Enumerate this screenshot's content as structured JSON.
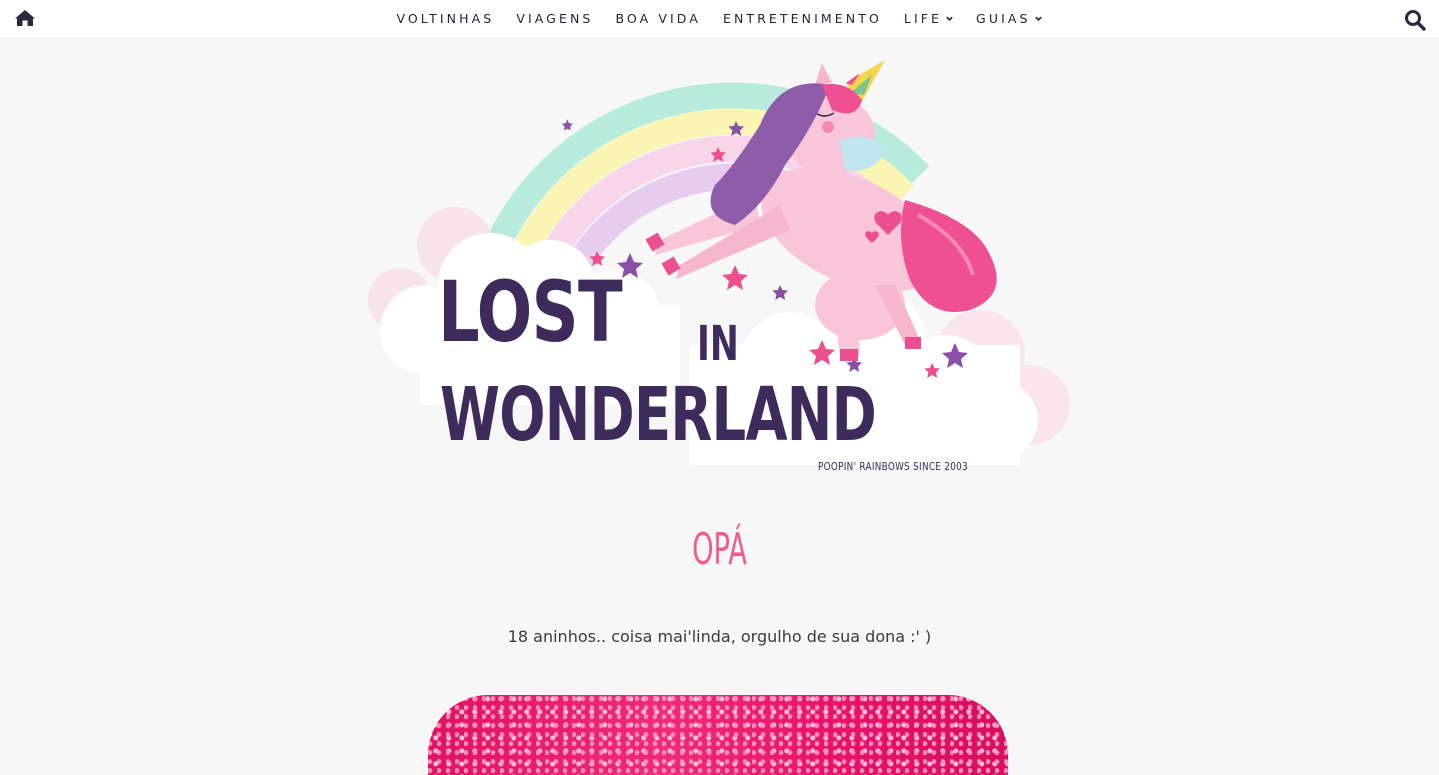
{
  "nav": {
    "items": [
      {
        "label": "VOLTINHAS",
        "dropdown": false
      },
      {
        "label": "VIAGENS",
        "dropdown": false
      },
      {
        "label": "BOA VIDA",
        "dropdown": false
      },
      {
        "label": "ENTRETENIMENTO",
        "dropdown": false
      },
      {
        "label": "LIFE",
        "dropdown": true
      },
      {
        "label": "GUIAS",
        "dropdown": true
      }
    ],
    "home_icon": "home-icon",
    "search_icon": "search-icon"
  },
  "logo": {
    "line1": "LOST",
    "in": "IN",
    "line2": "WONDERLAND",
    "tagline": "POOPIN' RAINBOWS SINCE 2003"
  },
  "post": {
    "title": "OPÁ",
    "text": "18 aninhos.. coisa mai'linda, orgulho de sua dona :' )"
  },
  "colors": {
    "title": "#ef5d8f",
    "logo_text": "#3e2b5c",
    "nav_text": "#25233a",
    "background": "#f7f7f8",
    "glitter": "#e8126a"
  }
}
